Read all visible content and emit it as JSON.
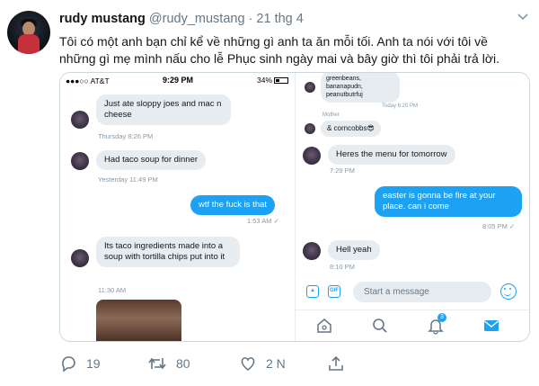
{
  "tweet": {
    "author_name": "rudy mustang",
    "author_handle": "@rudy_mustang",
    "separator": "·",
    "date": "21 thg 4",
    "text": "Tôi có một anh bạn chỉ kể về những gì anh ta ăn mỗi tối. Anh ta nói với tôi về những gì mẹ mình nấu cho lễ Phục sinh ngày mai và bây giờ thì tôi phải trả lời.",
    "colors": {
      "accent": "#1da1f2",
      "text": "#14171a",
      "muted": "#657786"
    }
  },
  "left_screenshot": {
    "status": {
      "carrier": "●●●○○ AT&T",
      "time": "9:29 PM",
      "battery": "34%"
    },
    "messages": [
      {
        "text": "Just ate sloppy joes and mac n cheese",
        "meta": "Thursday 8:26 PM",
        "direction": "in"
      },
      {
        "text": "Had taco soup for dinner",
        "meta": "Yesterday 11:49 PM",
        "direction": "in"
      },
      {
        "text": "wtf the fuck is that",
        "meta": "1:53 AM ✓",
        "direction": "out"
      },
      {
        "text": "Its taco ingredients made into a soup with tortilla chips put into it",
        "meta": "11:30 AM",
        "direction": "in"
      }
    ]
  },
  "right_screenshot": {
    "top_snippet": {
      "text": "greenbeans, bananapudn, peanutbutrfuj",
      "meta": "Today 6:20 PM",
      "sender": "Mother"
    },
    "messages": [
      {
        "text": "& corncobbs😎",
        "meta": "",
        "direction": "in"
      },
      {
        "text": "Heres the menu for tomorrow",
        "meta": "7:29 PM",
        "direction": "in"
      },
      {
        "text": "easter is gonna be fire at your place. can i come",
        "meta": "8:05 PM ✓",
        "direction": "out"
      },
      {
        "text": "Hell yeah",
        "meta": "8:10 PM",
        "direction": "in"
      }
    ],
    "composer": {
      "placeholder": "Start a message",
      "gif_label": "GIF"
    },
    "tabs": {
      "notifications_badge": "3"
    }
  },
  "actions": {
    "reply_count": "19",
    "retweet_count": "80",
    "like_count": "2 N"
  }
}
